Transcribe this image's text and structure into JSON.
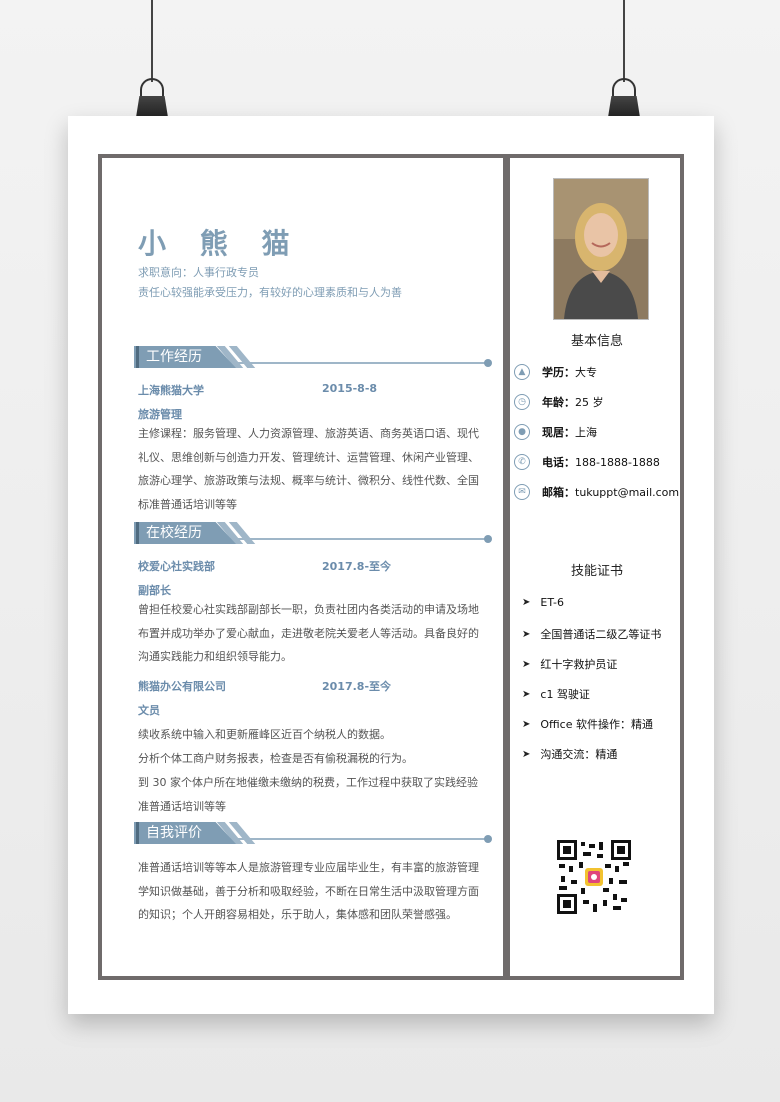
{
  "resume": {
    "name": "小 熊 猫",
    "intent": "求职意向：人事行政专员",
    "motto": "责任心较强能承受压力，有较好的心理素质和与人为善"
  },
  "work": {
    "title": "工作经历",
    "org": "上海熊猫大学",
    "date": "2015-8-8",
    "role": "旅游管理",
    "desc": "主修课程：服务管理、人力资源管理、旅游英语、商务英语口语、现代礼仪、思维创新与创造力开发、管理统计、运营管理、休闲产业管理、旅游心理学、旅游政策与法规、概率与统计、微积分、线性代数、全国标准普通话培训等等"
  },
  "school": {
    "title": "在校经历",
    "entries": [
      {
        "org": "校爱心社实践部",
        "date": "2017.8-至今",
        "role": "副部长",
        "desc": "曾担任校爱心社实践部副部长一职，负责社团内各类活动的申请及场地布置并成功举办了爱心献血，走进敬老院关爱老人等活动。具备良好的沟通实践能力和组织领导能力。"
      },
      {
        "org": "熊猫办公有限公司",
        "date": "2017.8-至今",
        "role": "文员",
        "lines": [
          "续收系统中输入和更新雁峰区近百个纳税人的数据。",
          "分析个体工商户财务报表，检查是否有偷税漏税的行为。",
          "到 30 家个体户所在地催缴未缴纳的税费，工作过程中获取了实践经验",
          "准普通话培训等等"
        ]
      }
    ]
  },
  "self": {
    "title": "自我评价",
    "desc": "准普通话培训等等本人是旅游管理专业应届毕业生，有丰富的旅游管理学知识做基础，善于分析和吸取经验，不断在日常生活中汲取管理方面的知识；个人开朗容易相处，乐于助人，集体感和团队荣誉感强。"
  },
  "basic_info": {
    "title": "基本信息",
    "items": [
      {
        "label": "学历：",
        "value": "大专",
        "icon": "graduation-cap-icon"
      },
      {
        "label": "年龄：",
        "value": "25 岁",
        "icon": "clock-icon"
      },
      {
        "label": "现居：",
        "value": "上海",
        "icon": "user-icon"
      },
      {
        "label": "电话：",
        "value": "188-1888-1888",
        "icon": "phone-icon"
      },
      {
        "label": "邮箱：",
        "value": "tukuppt@mail.com",
        "icon": "mail-icon"
      }
    ]
  },
  "skills": {
    "title": "技能证书",
    "items": [
      "ET-6",
      "全国普通话二级乙等证书",
      "红十字救护员证",
      "c1 驾驶证",
      "Office  软件操作：精通",
      "沟通交流：精通"
    ]
  },
  "colors": {
    "accent": "#7f9db4",
    "frame": "#6f6b6b"
  }
}
